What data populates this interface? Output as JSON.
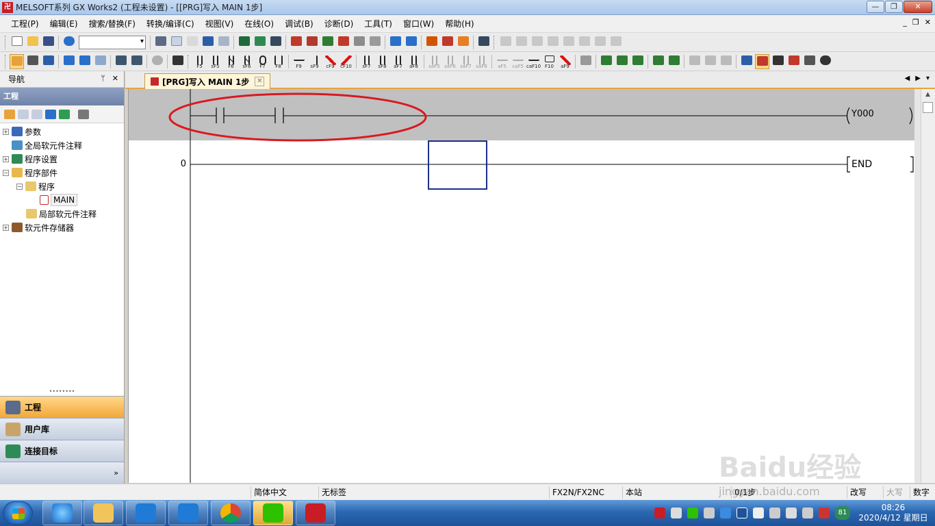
{
  "window": {
    "title": "MELSOFT系列 GX Works2 (工程未设置) - [[PRG]写入 MAIN 1步]",
    "app_icon_text": "卍",
    "controls": [
      "—",
      "❐",
      "✕"
    ]
  },
  "menubar": {
    "items": [
      "工程(P)",
      "编辑(E)",
      "搜索/替换(F)",
      "转换/编译(C)",
      "视图(V)",
      "在线(O)",
      "调试(B)",
      "诊断(D)",
      "工具(T)",
      "窗口(W)",
      "帮助(H)"
    ],
    "mdi_controls": [
      "_",
      "❐",
      "✕"
    ]
  },
  "toolbar2_fkeys": [
    "F5",
    "sF5",
    "F6",
    "sF6",
    "F7",
    "F8",
    "F9",
    "sF9",
    "cF9",
    "cF10",
    "sF7",
    "sF8",
    "aF7",
    "aF8",
    "saF5",
    "saF6",
    "saF7",
    "saF8",
    "aF5",
    "caF5",
    "caF10",
    "F10",
    "aF9"
  ],
  "nav": {
    "title": "导航",
    "pin": "ᛘ",
    "close": "✕",
    "section": "工程",
    "tree": [
      {
        "label": "参数",
        "indent": 0,
        "expander": "+"
      },
      {
        "label": "全局软元件注释",
        "indent": 0,
        "expander": ""
      },
      {
        "label": "程序设置",
        "indent": 0,
        "expander": "+"
      },
      {
        "label": "程序部件",
        "indent": 0,
        "expander": "−"
      },
      {
        "label": "程序",
        "indent": 1,
        "expander": "−"
      },
      {
        "label": "MAIN",
        "indent": 2,
        "expander": ""
      },
      {
        "label": "局部软元件注释",
        "indent": 1,
        "expander": ""
      },
      {
        "label": "软元件存储器",
        "indent": 0,
        "expander": "+"
      }
    ],
    "splitter": "••••••••",
    "tabs": [
      {
        "label": "工程",
        "active": true
      },
      {
        "label": "用户库",
        "active": false
      },
      {
        "label": "连接目标",
        "active": false
      }
    ],
    "more": "»"
  },
  "doc_tab": {
    "label": "[PRG]写入 MAIN 1步",
    "close": "✕",
    "nav_arrows": [
      "◀",
      "▶",
      "▾"
    ]
  },
  "ladder": {
    "rungs": [
      {
        "step": "",
        "coil": "Y000",
        "highlight": true
      },
      {
        "step": "0",
        "coil": "END",
        "highlight": false
      }
    ]
  },
  "statusbar": {
    "ime": "简体中文",
    "label": "无标签",
    "plc": "FX2N/FX2NC",
    "station": "本站",
    "steps": "0/1步",
    "mode": "改写",
    "caps": "大写",
    "num": "数字"
  },
  "taskbar": {
    "time": "08:26",
    "date": "2020/4/12 星期日",
    "badge": "81"
  },
  "watermark": {
    "logo": "Baidu经验",
    "url": "jingyan.baidu.com"
  },
  "colors": {
    "highlight_ellipse": "#d9191f",
    "cursor_box": "#1c2e8c",
    "active_tab": "#f3a73b"
  }
}
